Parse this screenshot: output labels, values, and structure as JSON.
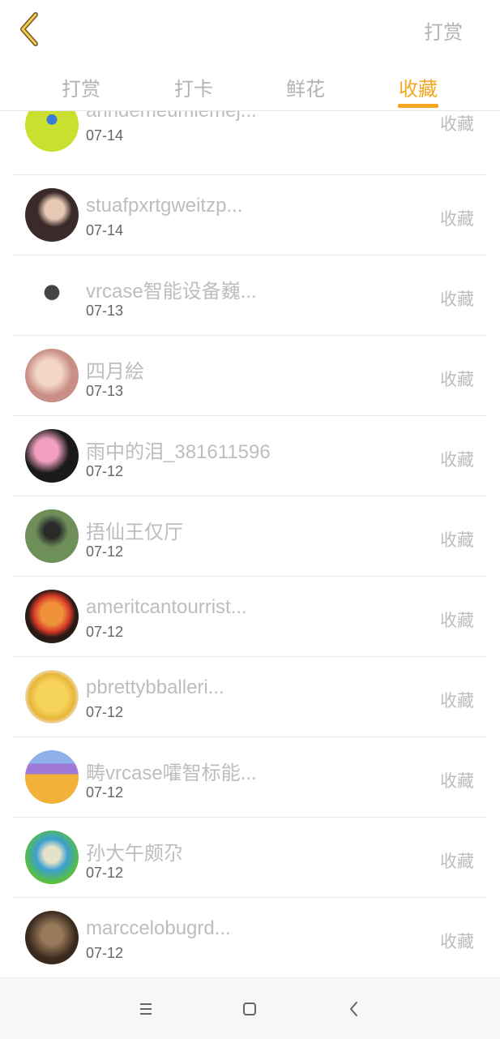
{
  "header": {
    "back_icon": "chevron-left-icon",
    "action_label": "打赏"
  },
  "tabs": [
    {
      "label": "打赏",
      "active": false
    },
    {
      "label": "打卡",
      "active": false
    },
    {
      "label": "鲜花",
      "active": false
    },
    {
      "label": "收藏",
      "active": true
    }
  ],
  "accent_color": "#f5a623",
  "rows": [
    {
      "name": "anndemeumlemej...",
      "date": "07-14",
      "status": "收藏"
    },
    {
      "name": "stuafpxrtgweitzp...",
      "date": "07-14",
      "status": "收藏"
    },
    {
      "name": "vrcase智能设备巍...",
      "date": "07-13",
      "status": "收藏"
    },
    {
      "name": "四月絵",
      "date": "07-13",
      "status": "收藏"
    },
    {
      "name": "雨中的泪_381611596",
      "date": "07-12",
      "status": "收藏"
    },
    {
      "name": "捂仙王仅厅",
      "date": "07-12",
      "status": "收藏"
    },
    {
      "name": "ameritcantourrist...",
      "date": "07-12",
      "status": "收藏"
    },
    {
      "name": "pbrettybballeri...",
      "date": "07-12",
      "status": "收藏"
    },
    {
      "name": "畴vrcase嚯智标能...",
      "date": "07-12",
      "status": "收藏"
    },
    {
      "name": "孙大午颇尕",
      "date": "07-12",
      "status": "收藏"
    },
    {
      "name": "marccelobugrd...",
      "date": "07-12",
      "status": "收藏"
    }
  ],
  "nav": {
    "menu_icon": "menu-icon",
    "home_icon": "square-home-icon",
    "back_icon": "back-arrow-icon"
  }
}
